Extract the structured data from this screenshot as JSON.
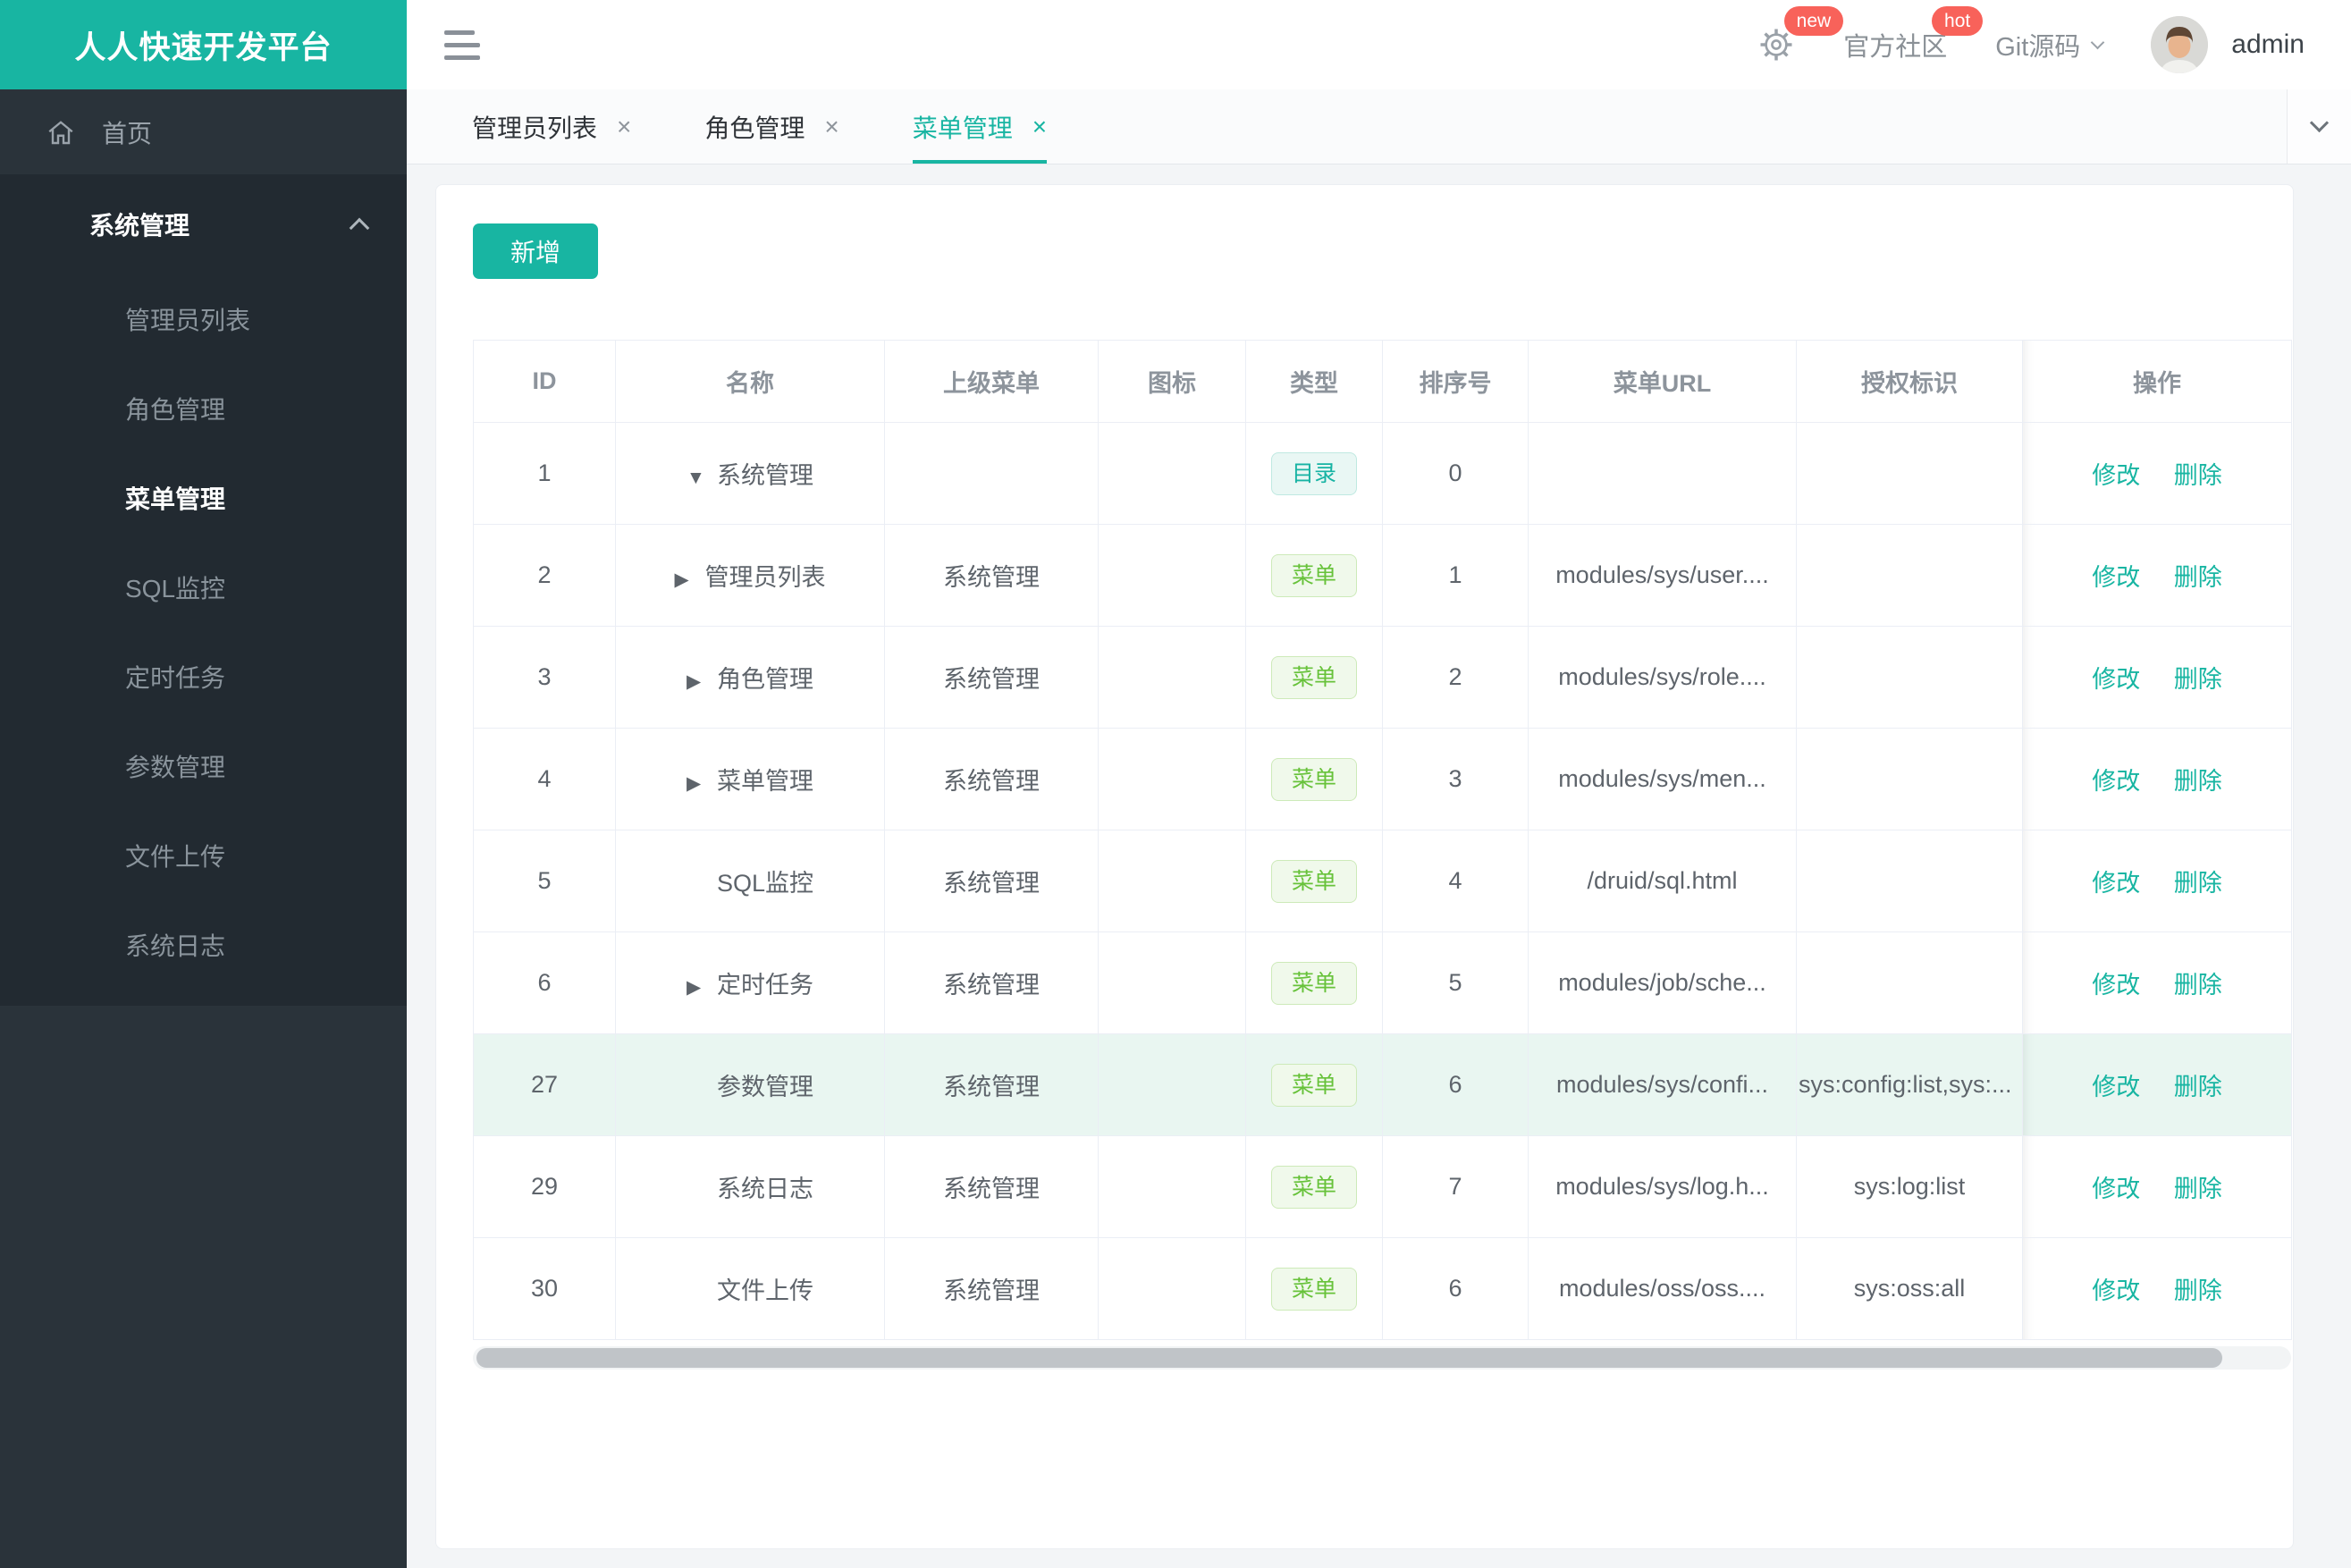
{
  "app": {
    "title": "人人快速开发平台"
  },
  "topbar": {
    "gear_badge": "new",
    "community_label": "官方社区",
    "community_badge": "hot",
    "git_label": "Git源码",
    "username": "admin"
  },
  "sidebar": {
    "home_label": "首页",
    "group_label": "系统管理",
    "items": [
      {
        "label": "管理员列表",
        "cls": ""
      },
      {
        "label": "角色管理",
        "cls": ""
      },
      {
        "label": "菜单管理",
        "cls": "active"
      },
      {
        "label": "SQL监控",
        "cls": ""
      },
      {
        "label": "定时任务",
        "cls": ""
      },
      {
        "label": "参数管理",
        "cls": ""
      },
      {
        "label": "文件上传",
        "cls": ""
      },
      {
        "label": "系统日志",
        "cls": ""
      }
    ]
  },
  "tabs": {
    "close_glyph": "×",
    "items": [
      {
        "label": "管理员列表",
        "cls": ""
      },
      {
        "label": "角色管理",
        "cls": ""
      },
      {
        "label": "菜单管理",
        "cls": "active"
      }
    ]
  },
  "toolbar": {
    "add_label": "新增"
  },
  "table": {
    "columns": [
      "ID",
      "名称",
      "上级菜单",
      "图标",
      "类型",
      "排序号",
      "菜单URL",
      "授权标识",
      "操作"
    ],
    "edit_label": "修改",
    "delete_label": "删除",
    "rows": [
      {
        "id": "1",
        "arrow": "down",
        "name": "系统管理",
        "parent": "",
        "type": "目录",
        "tag": "dir",
        "order": "0",
        "url": "",
        "perms": "",
        "cls": ""
      },
      {
        "id": "2",
        "arrow": "right",
        "name": "管理员列表",
        "parent": "系统管理",
        "type": "菜单",
        "tag": "menu",
        "order": "1",
        "url": "modules/sys/user....",
        "perms": "",
        "cls": ""
      },
      {
        "id": "3",
        "arrow": "right",
        "name": "角色管理",
        "parent": "系统管理",
        "type": "菜单",
        "tag": "menu",
        "order": "2",
        "url": "modules/sys/role....",
        "perms": "",
        "cls": ""
      },
      {
        "id": "4",
        "arrow": "right",
        "name": "菜单管理",
        "parent": "系统管理",
        "type": "菜单",
        "tag": "menu",
        "order": "3",
        "url": "modules/sys/men...",
        "perms": "",
        "cls": ""
      },
      {
        "id": "5",
        "arrow": "none",
        "name": "SQL监控",
        "parent": "系统管理",
        "type": "菜单",
        "tag": "menu",
        "order": "4",
        "url": "/druid/sql.html",
        "perms": "",
        "cls": ""
      },
      {
        "id": "6",
        "arrow": "right",
        "name": "定时任务",
        "parent": "系统管理",
        "type": "菜单",
        "tag": "menu",
        "order": "5",
        "url": "modules/job/sche...",
        "perms": "",
        "cls": ""
      },
      {
        "id": "27",
        "arrow": "none",
        "name": "参数管理",
        "parent": "系统管理",
        "type": "菜单",
        "tag": "menu",
        "order": "6",
        "url": "modules/sys/confi...",
        "perms": "sys:config:list,sys:...",
        "cls": "hl"
      },
      {
        "id": "29",
        "arrow": "none",
        "name": "系统日志",
        "parent": "系统管理",
        "type": "菜单",
        "tag": "menu",
        "order": "7",
        "url": "modules/sys/log.h...",
        "perms": "sys:log:list",
        "cls": ""
      },
      {
        "id": "30",
        "arrow": "none",
        "name": "文件上传",
        "parent": "系统管理",
        "type": "菜单",
        "tag": "menu",
        "order": "6",
        "url": "modules/oss/oss....",
        "perms": "sys:oss:all",
        "cls": ""
      }
    ]
  },
  "colors": {
    "primary": "#18b5a2",
    "badge_red": "#f8625a",
    "tag_dir": "#17b3a3",
    "tag_menu": "#67c23a",
    "row_highlight": "#e9f6f1"
  }
}
